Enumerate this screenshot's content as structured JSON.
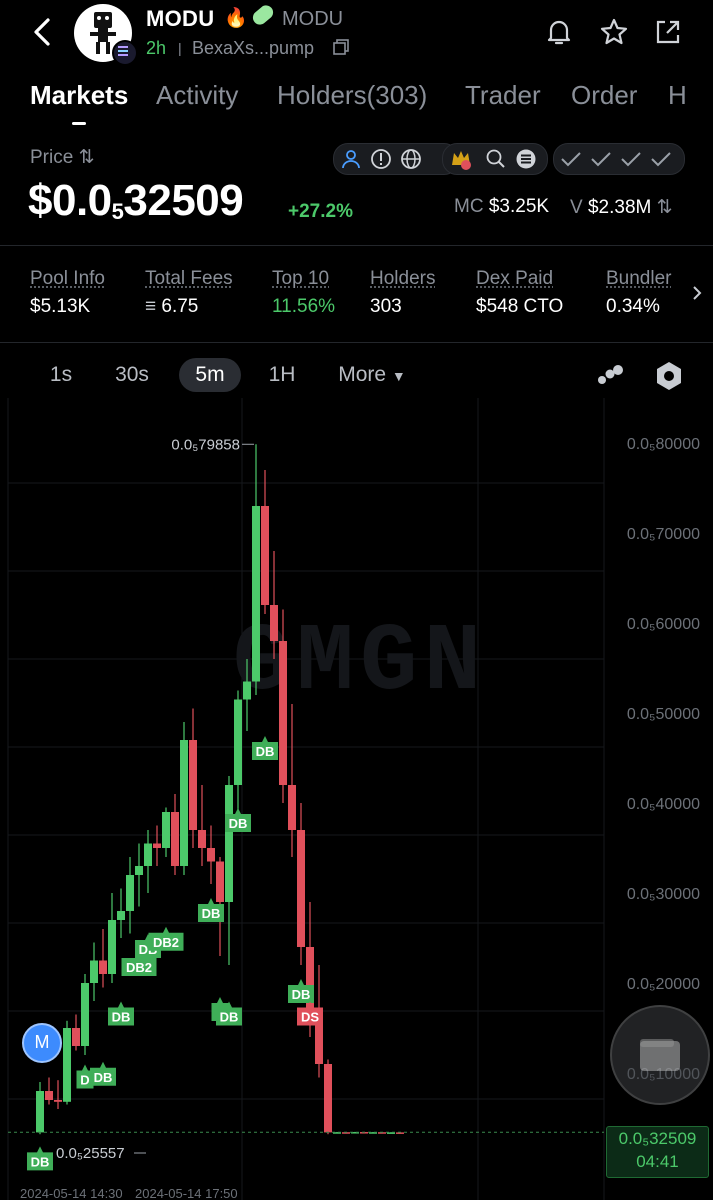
{
  "header": {
    "back_icon": "chevron-left-icon",
    "token_name": "MODU",
    "token_symbol": "MODU",
    "age": "2h",
    "address": "BexaXs...pump",
    "actions": [
      "bell-icon",
      "star-icon",
      "share-icon"
    ]
  },
  "tabs": [
    {
      "label": "Markets",
      "active": true
    },
    {
      "label": "Activity",
      "active": false
    },
    {
      "label": "Holders(303)",
      "active": false
    },
    {
      "label": "Trader",
      "active": false
    },
    {
      "label": "Order",
      "active": false
    },
    {
      "label": "H",
      "active": false
    }
  ],
  "price": {
    "label": "Price",
    "prefix": "$0.0",
    "zeros": "5",
    "digits": "32509",
    "change": "+27.2%",
    "mc_label": "MC",
    "mc_value": "$3.25K",
    "v_label": "V",
    "v_value": "$2.38M"
  },
  "stats": [
    {
      "label": "Pool Info",
      "value": "$5.13K"
    },
    {
      "label": "Total Fees",
      "value": "6.75"
    },
    {
      "label": "Top 10",
      "value": "11.56%"
    },
    {
      "label": "Holders",
      "value": "303"
    },
    {
      "label": "Dex Paid",
      "value": "$548 CTO"
    },
    {
      "label": "Bundler",
      "value": "0.34%"
    }
  ],
  "timeframes": {
    "options": [
      "1s",
      "30s",
      "5m",
      "1H"
    ],
    "active": "5m",
    "more_label": "More"
  },
  "chart_data": {
    "type": "candlestick",
    "watermark": "GMGN",
    "y_ticks": [
      "0.0₅80000",
      "0.0₅70000",
      "0.0₅60000",
      "0.0₅50000",
      "0.0₅40000",
      "0.0₅30000",
      "0.0₅20000",
      "0.0₅10000"
    ],
    "y_values": [
      80000,
      70000,
      60000,
      50000,
      40000,
      30000,
      20000,
      10000
    ],
    "high_label": "0.0₅79858",
    "low_label": "0.0₅25557",
    "current_price": "0.0₅32509",
    "countdown": "04:41",
    "x_labels": [
      "2024-05-14 14:30",
      "2024-05-14 17:50"
    ],
    "colors": {
      "up": "#4cc96a",
      "down": "#e0505b"
    },
    "candles": [
      {
        "o": 3400,
        "h": 9000,
        "l": 3200,
        "c": 8000
      },
      {
        "o": 8000,
        "h": 9500,
        "l": 6500,
        "c": 7000
      },
      {
        "o": 7000,
        "h": 9200,
        "l": 6000,
        "c": 6800
      },
      {
        "o": 6800,
        "h": 15800,
        "l": 6500,
        "c": 15000
      },
      {
        "o": 15000,
        "h": 16500,
        "l": 12500,
        "c": 13000
      },
      {
        "o": 13000,
        "h": 21000,
        "l": 12000,
        "c": 20000
      },
      {
        "o": 20000,
        "h": 24500,
        "l": 18000,
        "c": 22500
      },
      {
        "o": 22500,
        "h": 26000,
        "l": 19500,
        "c": 21000
      },
      {
        "o": 21000,
        "h": 30000,
        "l": 20000,
        "c": 27000
      },
      {
        "o": 27000,
        "h": 30500,
        "l": 25000,
        "c": 28000
      },
      {
        "o": 28000,
        "h": 34000,
        "l": 25500,
        "c": 32000
      },
      {
        "o": 32000,
        "h": 35500,
        "l": 28500,
        "c": 33000
      },
      {
        "o": 33000,
        "h": 37000,
        "l": 30000,
        "c": 35500
      },
      {
        "o": 35500,
        "h": 37500,
        "l": 33000,
        "c": 35000
      },
      {
        "o": 35000,
        "h": 39500,
        "l": 34000,
        "c": 39000
      },
      {
        "o": 39000,
        "h": 41000,
        "l": 32000,
        "c": 33000
      },
      {
        "o": 33000,
        "h": 49000,
        "l": 32000,
        "c": 47000
      },
      {
        "o": 47000,
        "h": 50500,
        "l": 35000,
        "c": 37000
      },
      {
        "o": 37000,
        "h": 42000,
        "l": 33000,
        "c": 35000
      },
      {
        "o": 35000,
        "h": 37500,
        "l": 31000,
        "c": 33500
      },
      {
        "o": 33500,
        "h": 34000,
        "l": 23000,
        "c": 29000
      },
      {
        "o": 29000,
        "h": 43000,
        "l": 22000,
        "c": 42000
      },
      {
        "o": 42000,
        "h": 52500,
        "l": 38000,
        "c": 51500
      },
      {
        "o": 51500,
        "h": 56000,
        "l": 48000,
        "c": 53500
      },
      {
        "o": 53500,
        "h": 79858,
        "l": 52000,
        "c": 73000
      },
      {
        "o": 73000,
        "h": 77000,
        "l": 61000,
        "c": 62000
      },
      {
        "o": 62000,
        "h": 68000,
        "l": 56000,
        "c": 58000
      },
      {
        "o": 58000,
        "h": 61500,
        "l": 40000,
        "c": 42000
      },
      {
        "o": 42000,
        "h": 51000,
        "l": 34000,
        "c": 37000
      },
      {
        "o": 37000,
        "h": 40000,
        "l": 22000,
        "c": 24000
      },
      {
        "o": 24000,
        "h": 29000,
        "l": 14000,
        "c": 16000
      },
      {
        "o": 16000,
        "h": 22000,
        "l": 9500,
        "c": 11000
      },
      {
        "o": 11000,
        "h": 11500,
        "l": 3200,
        "c": 3400
      },
      {
        "o": 3400,
        "h": 3450,
        "l": 3300,
        "c": 3420
      },
      {
        "o": 3420,
        "h": 3450,
        "l": 3350,
        "c": 3380
      },
      {
        "o": 3380,
        "h": 3460,
        "l": 3330,
        "c": 3440
      },
      {
        "o": 3440,
        "h": 3460,
        "l": 3350,
        "c": 3390
      },
      {
        "o": 3390,
        "h": 3450,
        "l": 3340,
        "c": 3420
      },
      {
        "o": 3420,
        "h": 3440,
        "l": 3300,
        "c": 3360
      },
      {
        "o": 3360,
        "h": 3430,
        "l": 3320,
        "c": 3400
      },
      {
        "o": 3400,
        "h": 3420,
        "l": 3310,
        "c": 3340
      }
    ],
    "markers": [
      {
        "label": "DB",
        "candle": 0,
        "price": 3400,
        "color": "green"
      },
      {
        "label": "D",
        "candle": 5,
        "price": 12500,
        "color": "green"
      },
      {
        "label": "DB",
        "candle": 7,
        "price": 12800,
        "color": "green"
      },
      {
        "label": "DB",
        "candle": 9,
        "price": 19500,
        "color": "green"
      },
      {
        "label": "DB2",
        "candle": 11,
        "price": 25000,
        "color": "green"
      },
      {
        "label": "DB",
        "candle": 12,
        "price": 27000,
        "color": "green"
      },
      {
        "label": "DB2",
        "candle": 14,
        "price": 27800,
        "color": "green"
      },
      {
        "label": "DB",
        "candle": 19,
        "price": 31000,
        "color": "green"
      },
      {
        "label": "D",
        "candle": 20,
        "price": 20000,
        "color": "green"
      },
      {
        "label": "DB",
        "candle": 21,
        "price": 19500,
        "color": "green"
      },
      {
        "label": "DB",
        "candle": 22,
        "price": 41000,
        "color": "green"
      },
      {
        "label": "DB",
        "candle": 25,
        "price": 49000,
        "color": "green"
      },
      {
        "label": "DB",
        "candle": 29,
        "price": 22000,
        "color": "green"
      },
      {
        "label": "DS",
        "candle": 30,
        "price": 19500,
        "color": "red"
      }
    ]
  }
}
